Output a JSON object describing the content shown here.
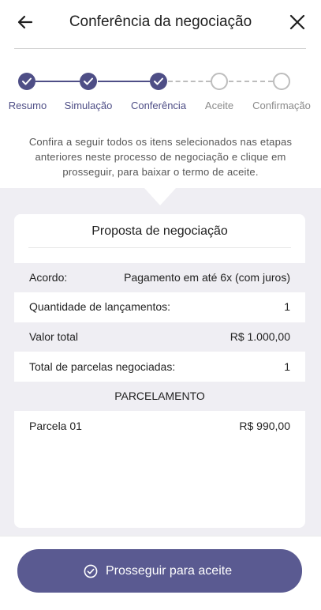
{
  "header": {
    "title": "Conferência da negociação",
    "back_icon": "arrow-left-icon",
    "close_icon": "close-icon"
  },
  "stepper": {
    "steps": [
      {
        "label": "Resumo",
        "status": "done"
      },
      {
        "label": "Simulação",
        "status": "done"
      },
      {
        "label": "Conferência",
        "status": "done"
      },
      {
        "label": "Aceite",
        "status": "todo"
      },
      {
        "label": "Confirmação",
        "status": "todo"
      }
    ]
  },
  "intro": "Confira a seguir todos os itens selecionados nas etapas anteriores neste processo de negociação e clique em prosseguir, para baixar o termo de aceite.",
  "card": {
    "title": "Proposta de negociação",
    "rows": [
      {
        "label": "Acordo:",
        "value": "Pagamento em até 6x (com juros)"
      },
      {
        "label": "Quantidade de lançamentos:",
        "value": "1"
      },
      {
        "label": "Valor total",
        "value": "R$ 1.000,00"
      },
      {
        "label": "Total de parcelas negociadas:",
        "value": "1"
      }
    ],
    "section_header": "PARCELAMENTO",
    "installments": [
      {
        "label": "Parcela 01",
        "value": "R$ 990,00"
      }
    ]
  },
  "cta": {
    "label": "Prosseguir para aceite",
    "icon": "check-circle-icon"
  },
  "colors": {
    "accent": "#4e4e86",
    "button": "#5a5a91",
    "shaded": "#efeef3",
    "inactive": "#bdbdbd"
  }
}
